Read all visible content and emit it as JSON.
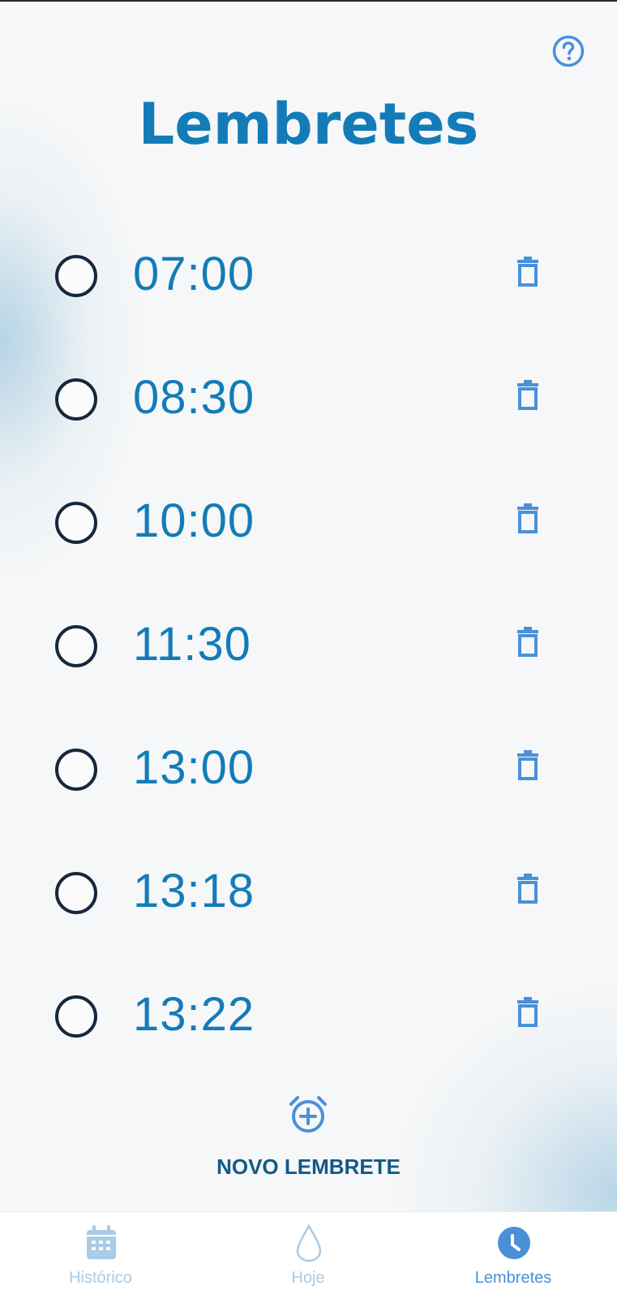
{
  "header": {
    "title": "Lembretes",
    "help_icon": "help-circle-icon"
  },
  "reminders": [
    {
      "time": "07:00"
    },
    {
      "time": "08:30"
    },
    {
      "time": "10:00"
    },
    {
      "time": "11:30"
    },
    {
      "time": "13:00"
    },
    {
      "time": "13:18"
    },
    {
      "time": "13:22"
    }
  ],
  "add_reminder": {
    "label": "NOVO LEMBRETE",
    "icon": "alarm-add-icon"
  },
  "bottom_nav": {
    "items": [
      {
        "label": "Histórico",
        "icon": "calendar-icon",
        "active": false
      },
      {
        "label": "Hoje",
        "icon": "water-drop-icon",
        "active": false
      },
      {
        "label": "Lembretes",
        "icon": "clock-icon",
        "active": true
      }
    ]
  },
  "colors": {
    "title": "#137cb8",
    "time": "#137cb8",
    "radio_border": "#16273d",
    "trash": "#4a90d9",
    "add_label": "#115a87",
    "nav_active": "#4a90d9",
    "nav_inactive": "#a9cbe8"
  }
}
